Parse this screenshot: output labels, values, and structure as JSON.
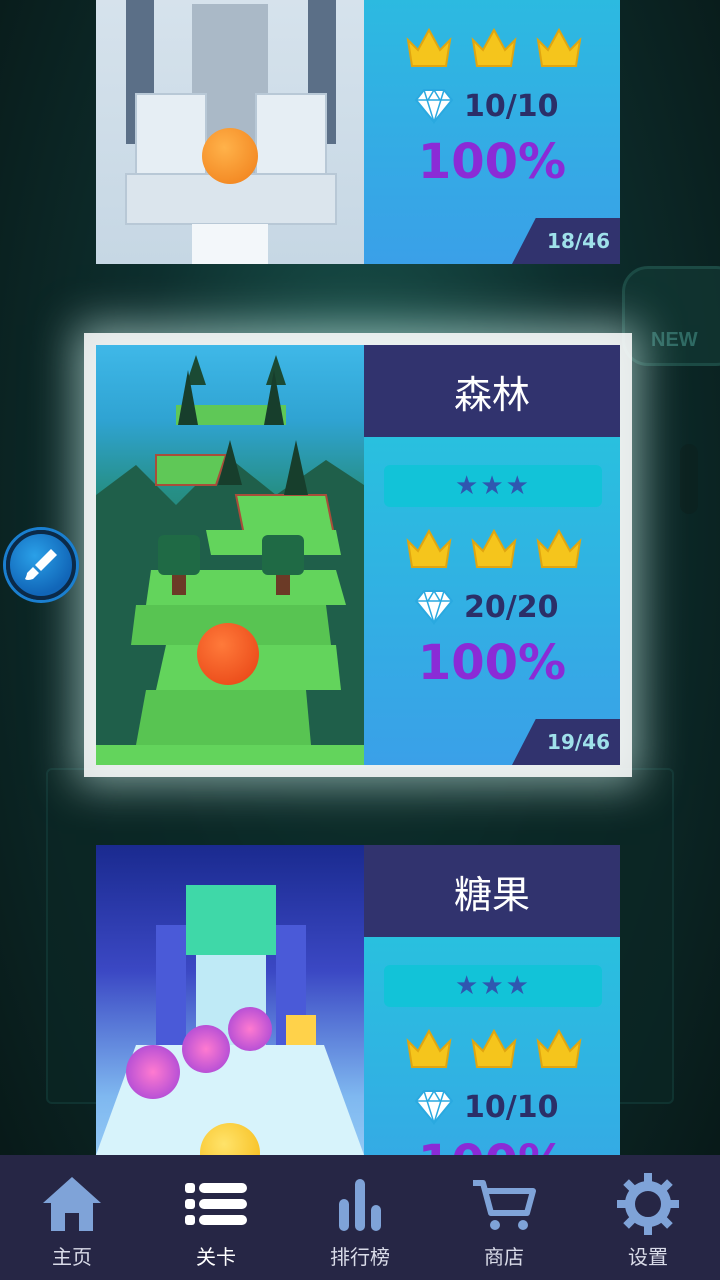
{
  "levels": [
    {
      "name": "",
      "crowns": 3,
      "gems": "10/10",
      "percent": "100%",
      "index": "18/46"
    },
    {
      "name": "森林",
      "crowns": 3,
      "gems": "20/20",
      "percent": "100%",
      "index": "19/46"
    },
    {
      "name": "糖果",
      "crowns": 3,
      "gems": "10/10",
      "percent": "100%",
      "index": ""
    }
  ],
  "side_badge": "NEW",
  "tabs": [
    {
      "label": "主页",
      "icon": "home-icon"
    },
    {
      "label": "关卡",
      "icon": "list-icon"
    },
    {
      "label": "排行榜",
      "icon": "leaderboard-icon"
    },
    {
      "label": "商店",
      "icon": "cart-icon"
    },
    {
      "label": "设置",
      "icon": "gear-icon"
    }
  ],
  "colors": {
    "accent": "#31336e",
    "percent": "#8b2bd6",
    "crown": "#f5c51c",
    "tabbar": "#262645"
  }
}
